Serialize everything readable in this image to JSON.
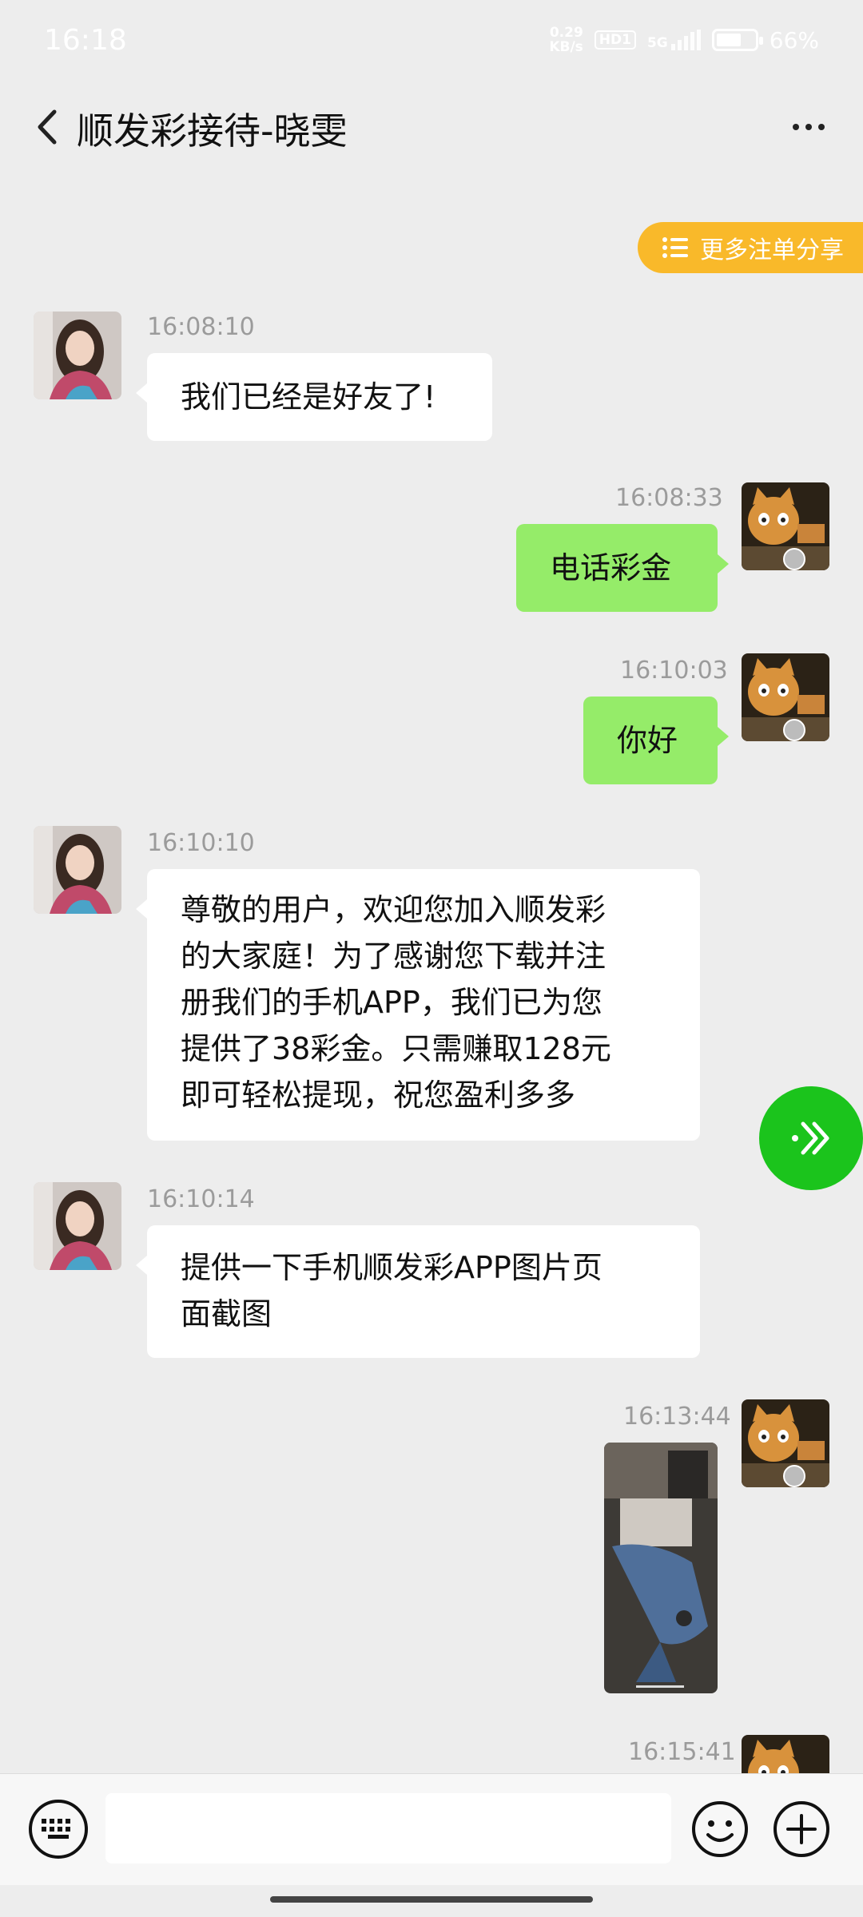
{
  "status_bar": {
    "time": "16:18",
    "net_speed_value": "0.29",
    "net_speed_unit": "KB/s",
    "hd_badge": "HD1",
    "network": "5G",
    "battery_percent": "66%",
    "battery_level": 0.66
  },
  "header": {
    "title": "顺发彩接待-晓雯",
    "back_icon": "chevron-left-icon",
    "more_icon": "more-horizontal-icon"
  },
  "share_pill": {
    "label": "更多注单分享",
    "icon": "list-icon",
    "color": "#f9b92a"
  },
  "messages": [
    {
      "side": "left",
      "time": "16:08:10",
      "text": "我们已经是好友了!"
    },
    {
      "side": "right",
      "time": "16:08:33",
      "text": "电话彩金"
    },
    {
      "side": "right",
      "time": "16:10:03",
      "text": "你好"
    },
    {
      "side": "left",
      "time": "16:10:10",
      "lines": [
        "尊敬的用户，欢迎您加入顺发彩",
        "的大家庭！为了感谢您下载并注",
        "册我们的手机APP，我们已为您",
        "提供了38彩金。只需赚取128元",
        "即可轻松提现，祝您盈利多多"
      ]
    },
    {
      "side": "left",
      "time": "16:10:14",
      "lines": [
        "提供一下手机顺发彩APP图片页",
        "面截图"
      ]
    },
    {
      "side": "right",
      "time": "16:13:44",
      "type": "image"
    },
    {
      "side": "right",
      "time": "16:15:41"
    }
  ],
  "fab": {
    "icon": "forward-arrows-icon",
    "color": "#1bc41c"
  },
  "input_bar": {
    "keyboard_icon": "keyboard-icon",
    "input_value": "",
    "emoji_icon": "emoji-icon",
    "plus_icon": "plus-icon"
  },
  "colors": {
    "background": "#ededed",
    "bubble_self": "#95ec69",
    "bubble_other": "#ffffff"
  }
}
